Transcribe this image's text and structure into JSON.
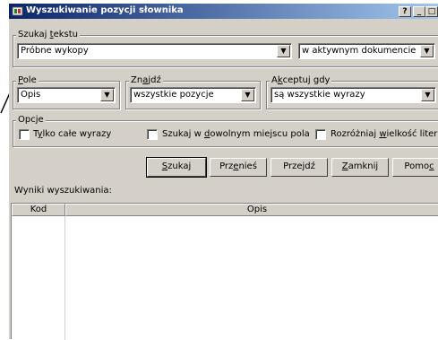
{
  "window": {
    "title": "Wyszukiwanie pozycji słownika",
    "help_btn": "?",
    "minimize_btn": "_",
    "maximize_btn": "□",
    "close_btn": "✕"
  },
  "search_text": {
    "label_pre": "Szukaj ",
    "label_key": "t",
    "label_post": "ekstu",
    "value": "Próbne wykopy",
    "scope_value": "w aktywnym dokumencie"
  },
  "field": {
    "label_key": "P",
    "label_post": "ole",
    "value": "Opis"
  },
  "find": {
    "label_pre": "Zn",
    "label_key": "a",
    "label_post": "jdź",
    "value": "wszystkie pozycje"
  },
  "accept": {
    "label_pre": "A",
    "label_key": "k",
    "label_post": "ceptuj gdy",
    "value": "są wszystkie wyrazy"
  },
  "options": {
    "label": "Opcje",
    "whole_words": {
      "pre": "T",
      "key": "y",
      "post": "lko całe wyrazy"
    },
    "anywhere": {
      "pre": "Szukaj w ",
      "key": "d",
      "post": "owolnym miejscu pola"
    },
    "case": {
      "pre": "Rozróżniaj ",
      "key": "w",
      "post": "ielkość liter"
    }
  },
  "buttons": {
    "search": {
      "pre": "",
      "key": "S",
      "post": "zukaj"
    },
    "move": {
      "pre": "Prz",
      "key": "e",
      "post": "nieś"
    },
    "goto": {
      "pre": "Przejdź",
      "key": "",
      "post": ""
    },
    "close": {
      "pre": "",
      "key": "Z",
      "post": "amknij"
    },
    "help": {
      "pre": "Pomo",
      "key": "c",
      "post": ""
    }
  },
  "results": {
    "label": "Wyniki wyszukiwania:",
    "columns": [
      "Kod",
      "Opis"
    ]
  },
  "colors": {
    "title_start": "#0a246a",
    "title_end": "#a6caf0",
    "face": "#d4d0c8"
  }
}
